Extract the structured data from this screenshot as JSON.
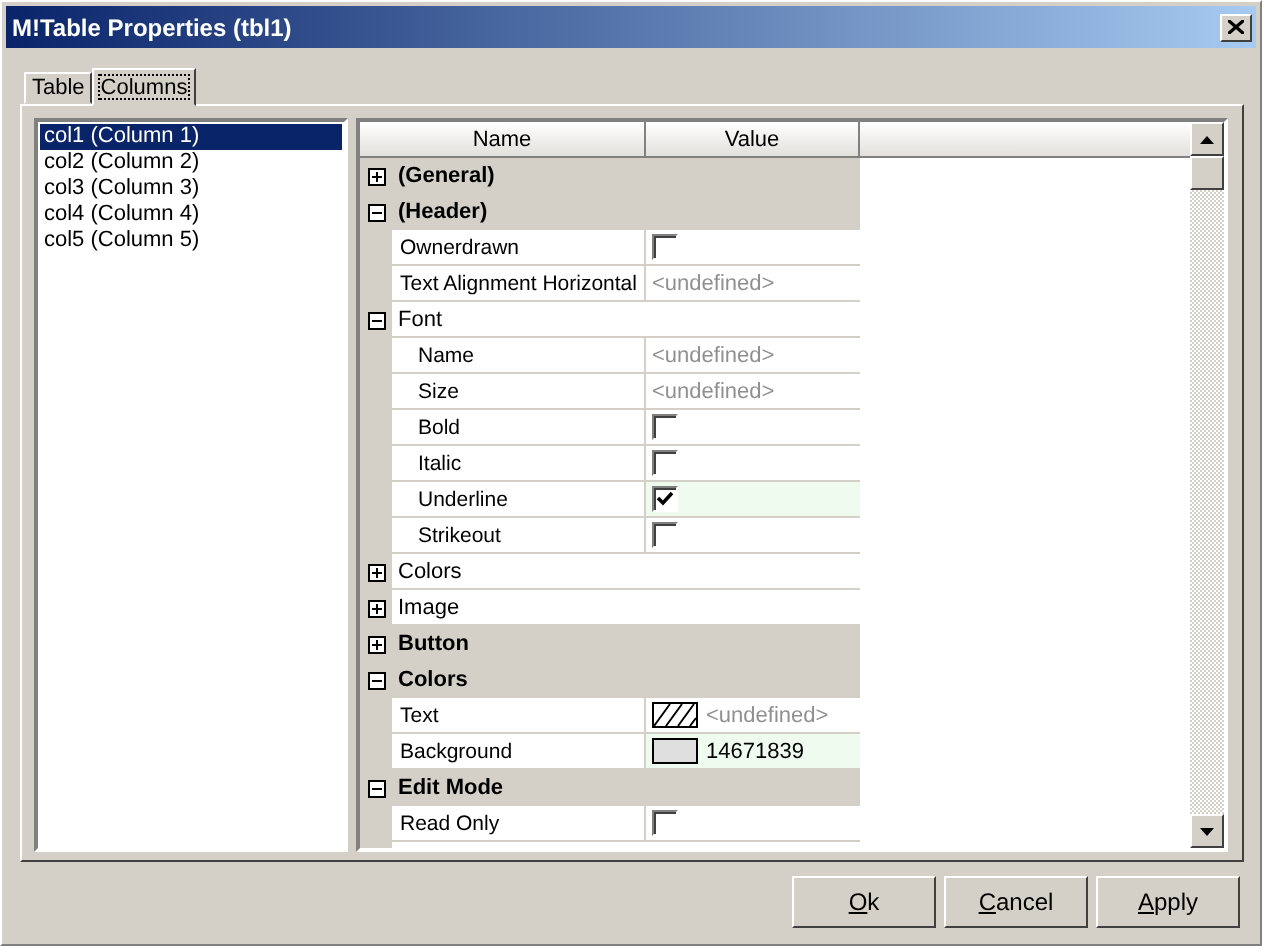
{
  "window": {
    "title": "M!Table Properties (tbl1)"
  },
  "tabs": [
    {
      "label": "Table",
      "selected": false
    },
    {
      "label": "Columns",
      "selected": true
    }
  ],
  "columns_list": [
    {
      "label": "col1 (Column 1)",
      "selected": true
    },
    {
      "label": "col2 (Column 2)",
      "selected": false
    },
    {
      "label": "col3 (Column 3)",
      "selected": false
    },
    {
      "label": "col4 (Column 4)",
      "selected": false
    },
    {
      "label": "col5 (Column 5)",
      "selected": false
    }
  ],
  "grid": {
    "columns": [
      "Name",
      "Value"
    ],
    "rows": [
      {
        "kind": "category",
        "label": "(General)",
        "expanded": false
      },
      {
        "kind": "category",
        "label": "(Header)",
        "expanded": true,
        "children": [
          {
            "kind": "checkbox",
            "label": "Ownerdrawn",
            "checked": false,
            "modified": false
          },
          {
            "kind": "text",
            "label": "Text Alignment Horizontal",
            "value": "<undefined>",
            "dimmed": true,
            "modified": false
          },
          {
            "kind": "group",
            "label": "Font",
            "expanded": true,
            "children": [
              {
                "kind": "text",
                "label": "Name",
                "value": "<undefined>",
                "dimmed": true,
                "modified": false
              },
              {
                "kind": "text",
                "label": "Size",
                "value": "<undefined>",
                "dimmed": true,
                "modified": false
              },
              {
                "kind": "checkbox",
                "label": "Bold",
                "checked": false,
                "modified": false
              },
              {
                "kind": "checkbox",
                "label": "Italic",
                "checked": false,
                "modified": false
              },
              {
                "kind": "checkbox",
                "label": "Underline",
                "checked": true,
                "modified": true
              },
              {
                "kind": "checkbox",
                "label": "Strikeout",
                "checked": false,
                "modified": false
              }
            ]
          },
          {
            "kind": "group",
            "label": "Colors",
            "expanded": false
          },
          {
            "kind": "group",
            "label": "Image",
            "expanded": false
          }
        ]
      },
      {
        "kind": "category",
        "label": "Button",
        "expanded": false
      },
      {
        "kind": "category",
        "label": "Colors",
        "expanded": true,
        "children": [
          {
            "kind": "color",
            "label": "Text",
            "value": "<undefined>",
            "dimmed": true,
            "modified": false
          },
          {
            "kind": "color",
            "label": "Background",
            "color": "#dfdfdf",
            "value": "14671839",
            "dimmed": false,
            "modified": true
          }
        ]
      },
      {
        "kind": "category",
        "label": "Edit Mode",
        "expanded": true,
        "children": [
          {
            "kind": "checkbox",
            "label": "Read Only",
            "checked": false,
            "modified": false
          }
        ]
      }
    ]
  },
  "buttons": [
    {
      "access_key": "O",
      "label_rest": "k"
    },
    {
      "access_key": "C",
      "label_rest": "ancel"
    },
    {
      "access_key": "A",
      "label_rest": "pply"
    }
  ]
}
